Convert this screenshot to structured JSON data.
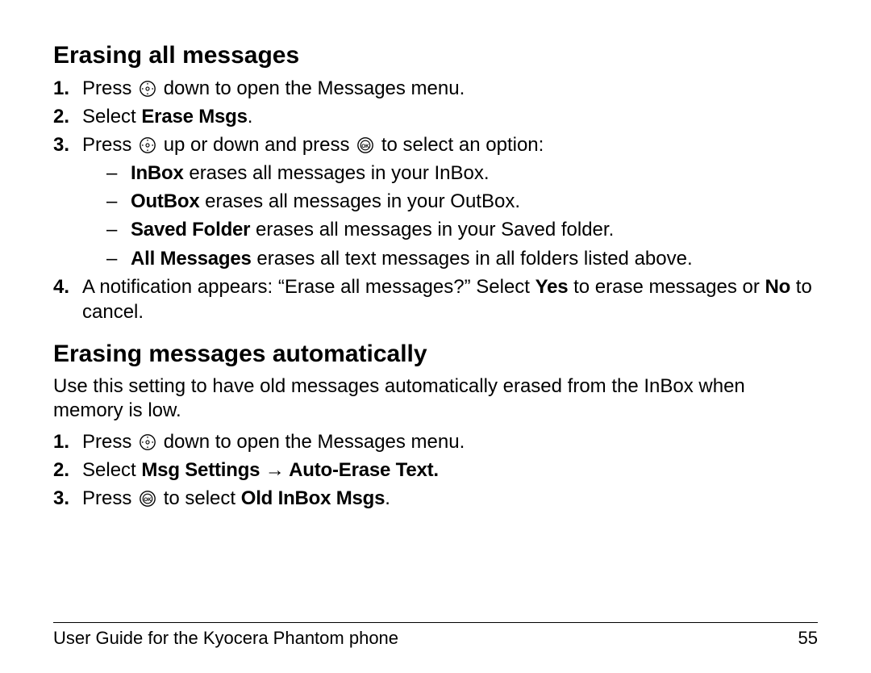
{
  "section1": {
    "heading": "Erasing all messages",
    "steps": {
      "s1": {
        "pre": "Press ",
        "post": " down to open the Messages menu."
      },
      "s2": {
        "pre": "Select ",
        "bold": "Erase Msgs",
        "post": "."
      },
      "s3": {
        "pre": "Press ",
        "mid": " up or down and press ",
        "post": " to select an option:"
      },
      "sub": {
        "a": {
          "bold": "InBox",
          "rest": " erases all messages in your InBox."
        },
        "b": {
          "bold": "OutBox",
          "rest": " erases all messages in your OutBox."
        },
        "c": {
          "bold": "Saved Folder",
          "rest": " erases all messages in your Saved folder."
        },
        "d": {
          "bold": "All Messages",
          "rest": " erases all text messages in all folders listed above."
        }
      },
      "s4": {
        "t1": "A notification appears: “Erase all messages?” Select ",
        "yes": "Yes",
        "t2": " to erase messages or ",
        "no": "No",
        "t3": " to cancel."
      }
    }
  },
  "section2": {
    "heading": "Erasing messages automatically",
    "intro": "Use this setting to have old messages automatically erased from the InBox when memory is low.",
    "steps": {
      "s1": {
        "pre": "Press ",
        "post": " down to open the Messages menu."
      },
      "s2": {
        "pre": "Select ",
        "bold": "Msg Settings → Auto-Erase Text."
      },
      "s3": {
        "pre": "Press ",
        "mid": " to select ",
        "bold": "Old InBox Msgs",
        "post": "."
      }
    }
  },
  "footer": {
    "left": "User Guide for the Kyocera Phantom phone",
    "right": "55"
  }
}
